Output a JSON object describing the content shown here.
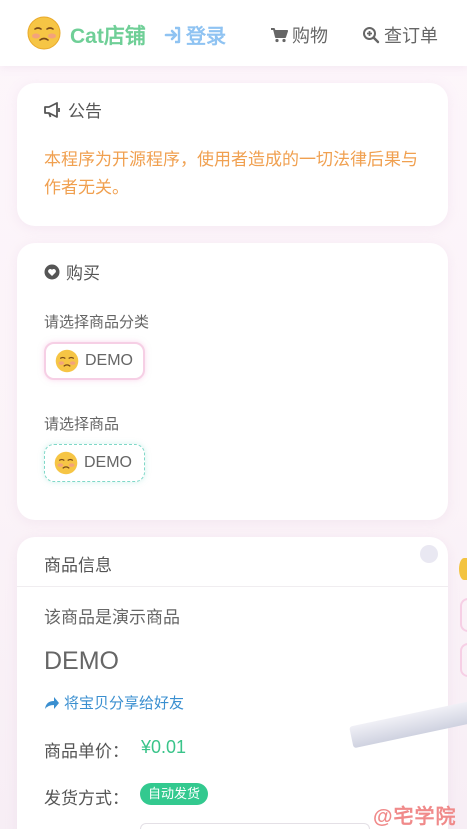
{
  "navbar": {
    "brand": "Cat店铺",
    "login_label": "登录",
    "shop_label": "购物",
    "order_label": "查订单",
    "logo_icon": "blushing-face-icon"
  },
  "notice": {
    "title": "公告",
    "icon": "megaphone-icon",
    "text": "本程序为开源程序，使用者造成的一切法律后果与作者无关。"
  },
  "buy": {
    "title": "购买",
    "icon": "heart-circle-icon",
    "category_label": "请选择商品分类",
    "category_value": "DEMO",
    "product_label": "请选择商品",
    "product_value": "DEMO"
  },
  "info": {
    "title": "商品信息",
    "description": "该商品是演示商品",
    "product_name": "DEMO",
    "share_label": "将宝贝分享给好友",
    "price_label": "商品单价：",
    "price_value": "¥0.01",
    "shipping_label": "发货方式：",
    "shipping_value": "自动发货"
  },
  "watermark": "@宅学院",
  "colors": {
    "brand": "#6fcf97",
    "login": "#8fc3f2",
    "notice_text": "#f0a050",
    "price": "#3ac48a",
    "badge": "#33c98f",
    "link": "#3a8fd0"
  }
}
